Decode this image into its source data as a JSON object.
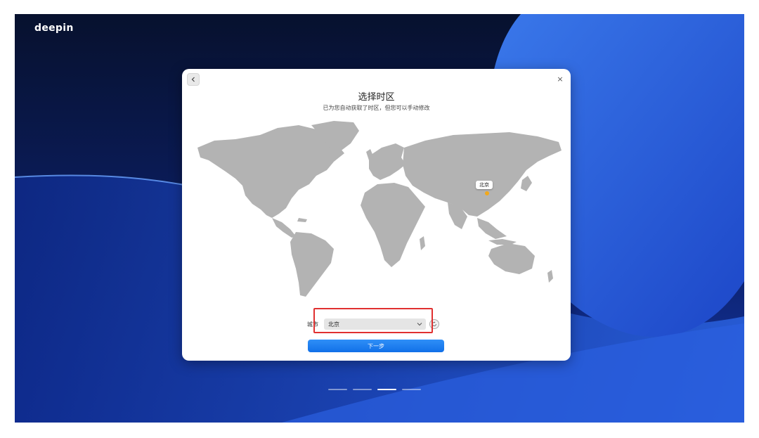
{
  "desktop": {
    "brand": "deepin"
  },
  "dialog": {
    "title": "选择时区",
    "subtitle": "已为您自动获取了时区，但您可以手动修改",
    "back_icon": "chevron-left-icon",
    "close_icon": "close-icon",
    "close_glyph": "×"
  },
  "map": {
    "selected_city_label": "北京",
    "land_color": "#b3b3b3",
    "marker_color": "#f2a81b"
  },
  "city_field": {
    "label": "城市",
    "value": "北京",
    "dropdown_icon": "chevron-down-icon",
    "refresh_icon": "refresh-icon"
  },
  "next_button": {
    "label": "下一步",
    "color": "#1a7ff0"
  },
  "pager": {
    "count": 4,
    "active_index": 2
  },
  "highlight_color": "#e03030"
}
